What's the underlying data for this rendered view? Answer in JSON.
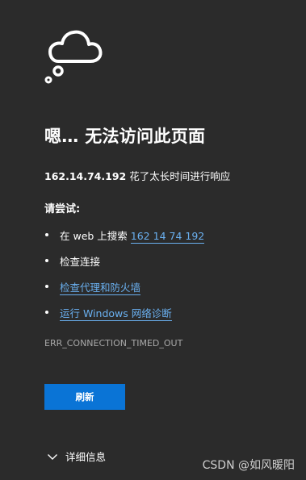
{
  "page": {
    "title": "嗯… 无法访问此页面",
    "host": "162.14.74.192",
    "description_suffix": " 花了太长时间进行响应",
    "try_heading": "请尝试:",
    "error_code": "ERR_CONNECTION_TIMED_OUT",
    "icon": "cloud-thought-icon"
  },
  "suggestions": [
    {
      "prefix": "在 web 上搜索 ",
      "link": "162 14 74 192"
    },
    {
      "text": "检查连接"
    },
    {
      "link": "检查代理和防火墙"
    },
    {
      "link": "运行 Windows 网络诊断"
    }
  ],
  "actions": {
    "refresh_label": "刷新",
    "details_label": "详细信息",
    "details_icon": "chevron-down-icon"
  },
  "watermark": "CSDN @如风暖阳",
  "colors": {
    "background": "#2b2b2b",
    "link": "#6ab0f0",
    "button": "#0a74d6",
    "muted": "#a8a8a8"
  }
}
